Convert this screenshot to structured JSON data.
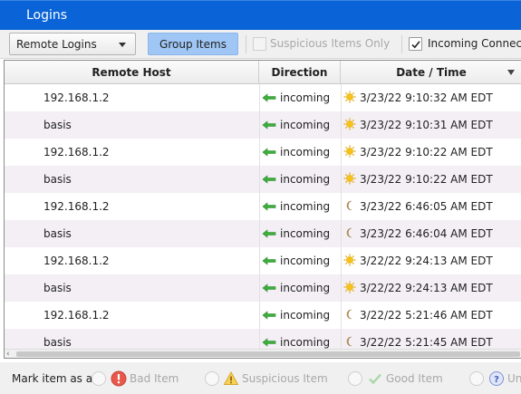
{
  "window": {
    "title": "Logins"
  },
  "toolbar": {
    "view_select": "Remote Logins",
    "group_button": "Group Items",
    "suspicious_only": {
      "label": "Suspicious Items Only",
      "checked": false,
      "enabled": false
    },
    "incoming_connections": {
      "label": "Incoming Connectio",
      "checked": true,
      "enabled": true
    }
  },
  "table": {
    "columns": [
      "Remote Host",
      "Direction",
      "Date / Time"
    ],
    "sort_column": "Date / Time",
    "sort_order": "descending",
    "rows": [
      {
        "host": "192.168.1.2",
        "direction": "incoming",
        "time_icon": "sun-icon",
        "datetime": "3/23/22 9:10:32 AM EDT"
      },
      {
        "host": "basis",
        "direction": "incoming",
        "time_icon": "sun-icon",
        "datetime": "3/23/22 9:10:31 AM EDT"
      },
      {
        "host": "192.168.1.2",
        "direction": "incoming",
        "time_icon": "sun-icon",
        "datetime": "3/23/22 9:10:22 AM EDT"
      },
      {
        "host": "basis",
        "direction": "incoming",
        "time_icon": "sun-icon",
        "datetime": "3/23/22 9:10:22 AM EDT"
      },
      {
        "host": "192.168.1.2",
        "direction": "incoming",
        "time_icon": "moon-icon",
        "datetime": "3/23/22 6:46:05 AM EDT"
      },
      {
        "host": "basis",
        "direction": "incoming",
        "time_icon": "moon-icon",
        "datetime": "3/23/22 6:46:04 AM EDT"
      },
      {
        "host": "192.168.1.2",
        "direction": "incoming",
        "time_icon": "sun-icon",
        "datetime": "3/22/22 9:24:13 AM EDT"
      },
      {
        "host": "basis",
        "direction": "incoming",
        "time_icon": "sun-icon",
        "datetime": "3/22/22 9:24:13 AM EDT"
      },
      {
        "host": "192.168.1.2",
        "direction": "incoming",
        "time_icon": "moon-icon",
        "datetime": "3/22/22 5:21:46 AM EDT"
      },
      {
        "host": "basis",
        "direction": "incoming",
        "time_icon": "moon-icon",
        "datetime": "3/22/22 5:21:45 AM EDT"
      }
    ]
  },
  "footer": {
    "mark_label": "Mark item as a",
    "options": [
      {
        "label": "Bad Item",
        "icon": "bad-item-icon"
      },
      {
        "label": "Suspicious Item",
        "icon": "warning-icon"
      },
      {
        "label": "Good Item",
        "icon": "checkmark-icon"
      },
      {
        "label": "Un",
        "icon": "question-icon"
      }
    ]
  },
  "colors": {
    "titlebar": "#0a64d8",
    "group_button": "#9fc6f5",
    "row_alt": "#f3eff5",
    "arrow_green": "#3cae3c",
    "sun": "#f6c21a",
    "moon": "#c9a066",
    "bad_item": "#e8584a"
  }
}
